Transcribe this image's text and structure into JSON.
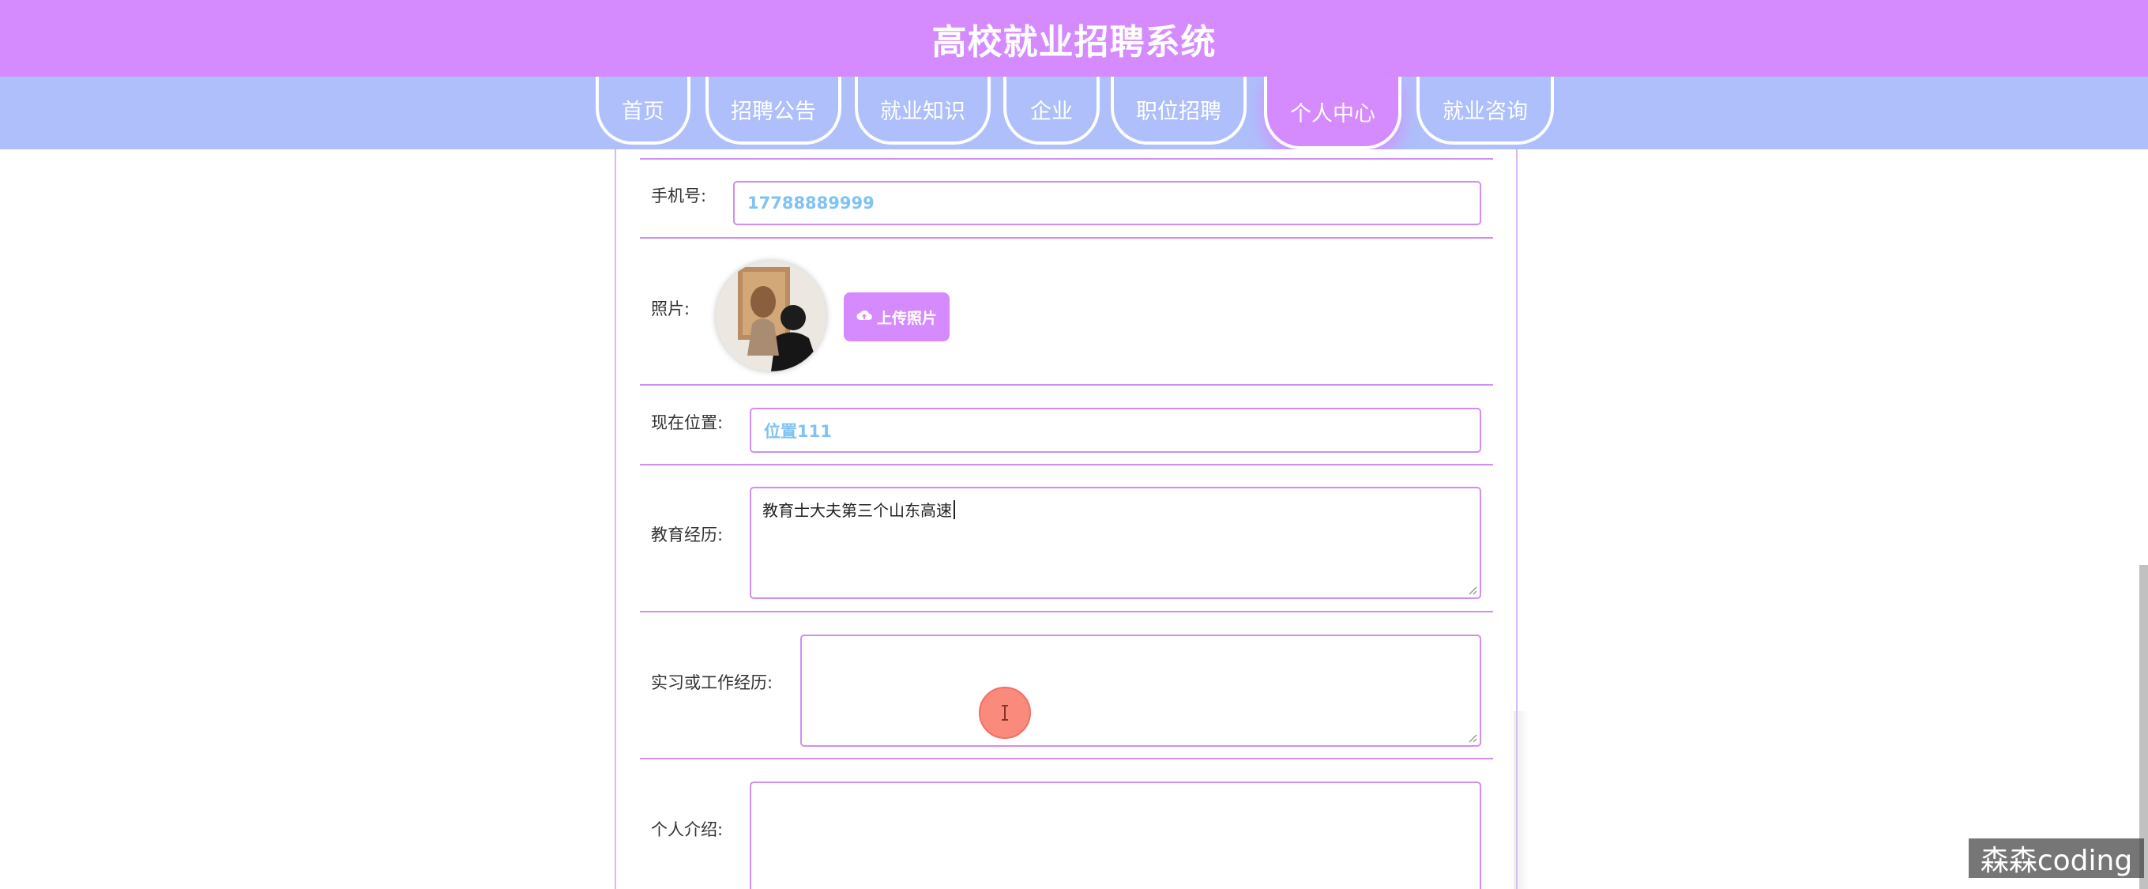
{
  "header": {
    "title": "高校就业招聘系统"
  },
  "nav": {
    "items": [
      {
        "label": "首页"
      },
      {
        "label": "招聘公告"
      },
      {
        "label": "就业知识"
      },
      {
        "label": "企业"
      },
      {
        "label": "职位招聘"
      },
      {
        "label": "个人中心",
        "active": true
      },
      {
        "label": "就业咨询"
      }
    ]
  },
  "form": {
    "phone": {
      "label": "手机号:",
      "value": "17788889999"
    },
    "photo": {
      "label": "照片:",
      "upload_label": "上传照片",
      "upload_icon": "cloud-upload-icon"
    },
    "location": {
      "label": "现在位置:",
      "value": "位置111"
    },
    "education": {
      "label": "教育经历:",
      "value": "教育士大夫第三个山东高速"
    },
    "experience": {
      "label": "实习或工作经历:",
      "value": ""
    },
    "intro": {
      "label": "个人介绍:",
      "value": ""
    }
  },
  "watermark": {
    "text": "森森coding"
  },
  "colors": {
    "header_bg": "#d58bfd",
    "nav_bg": "#aebffb",
    "accent": "#d08ef0",
    "input_text": "#7fc2f3"
  }
}
